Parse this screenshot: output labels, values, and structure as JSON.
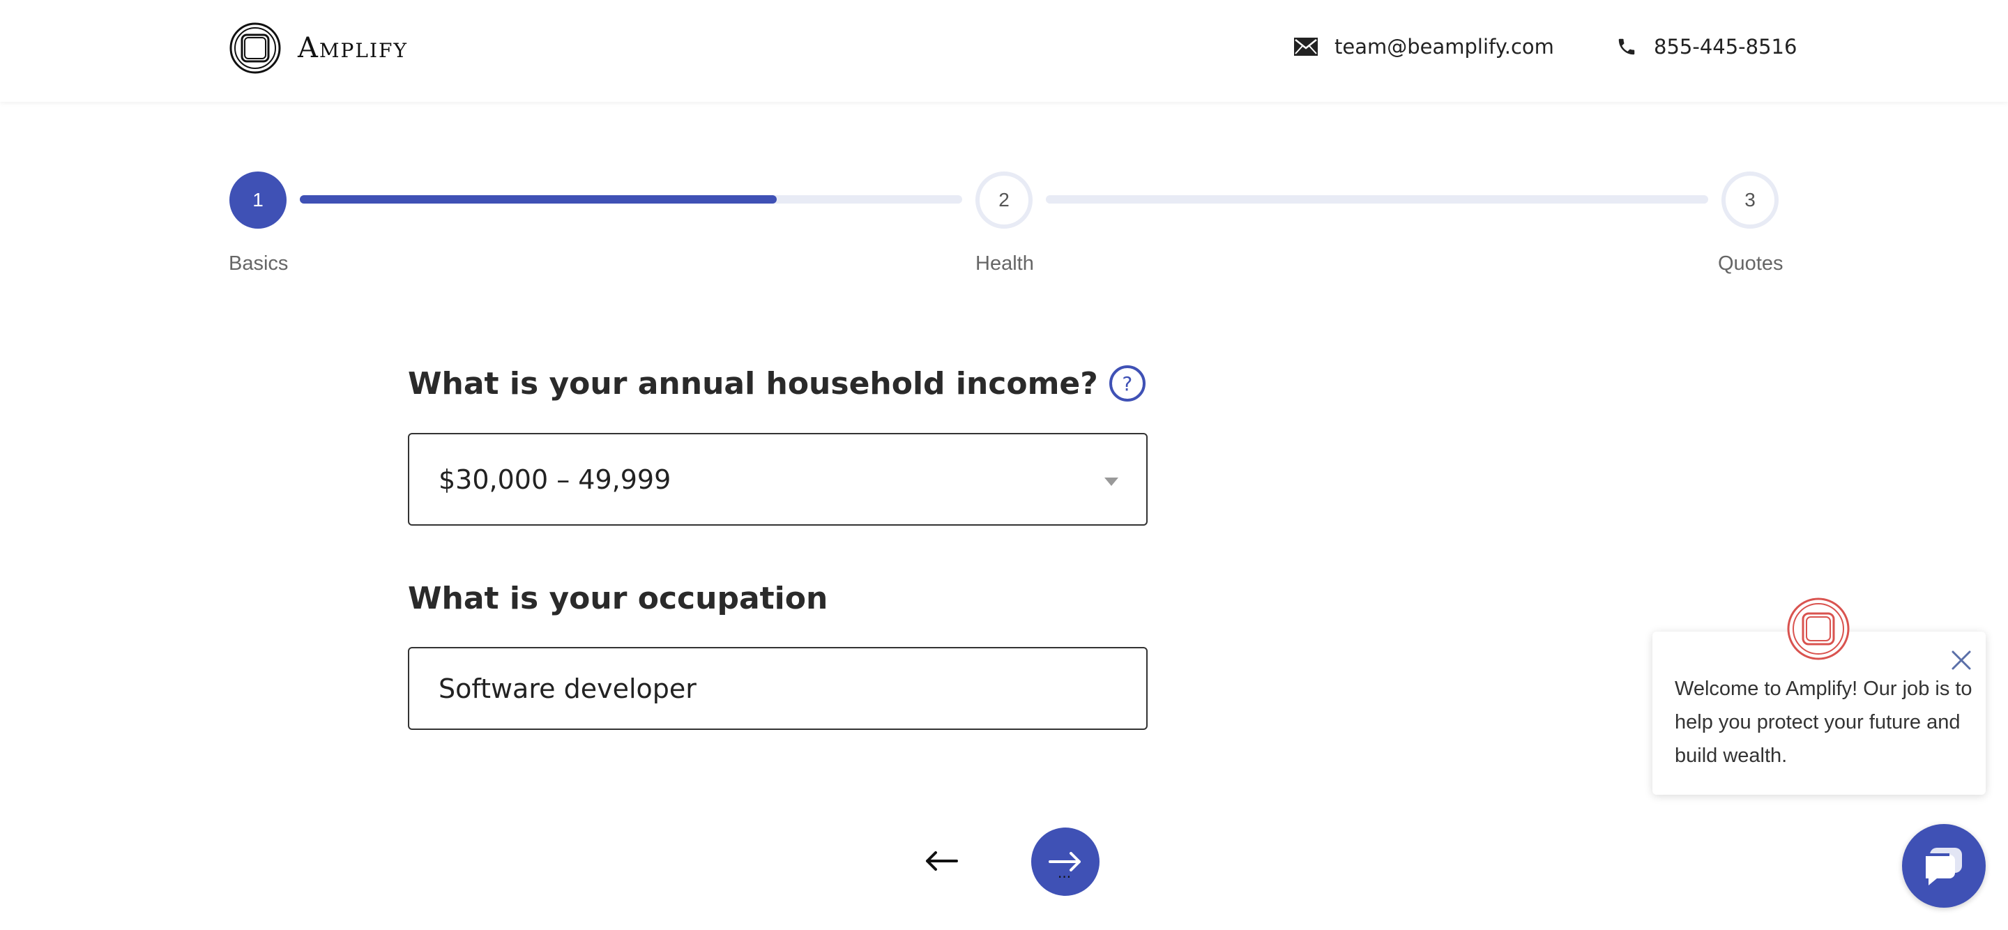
{
  "brand": {
    "name": "Amplify",
    "logo_icon": "amplify-logo-icon"
  },
  "header": {
    "email": "team@beamplify.com",
    "email_icon": "envelope-icon",
    "phone": "855-445-8516",
    "phone_icon": "phone-icon"
  },
  "stepper": {
    "steps": [
      {
        "number": "1",
        "label": "Basics",
        "state": "active"
      },
      {
        "number": "2",
        "label": "Health",
        "state": "upcoming"
      },
      {
        "number": "3",
        "label": "Quotes",
        "state": "upcoming"
      }
    ],
    "progress_segment_1": 0.72,
    "progress_segment_2": 0,
    "colors": {
      "active": "#3f51b5",
      "track": "#e8ebf5"
    }
  },
  "form": {
    "income_question": "What is your annual household income?",
    "income_help_icon": "?",
    "income_value": "$30,000 – 49,999",
    "occupation_question": "What is your occupation",
    "occupation_value": "Software developer"
  },
  "nav": {
    "back_icon": "arrow-left-icon",
    "next_icon": "arrow-right-icon",
    "next_loading": "..."
  },
  "chat": {
    "message": "Welcome to Amplify! Our job is to help you protect your future and build wealth.",
    "close_icon": "close-icon",
    "launcher_icon": "chat-bubble-icon"
  }
}
